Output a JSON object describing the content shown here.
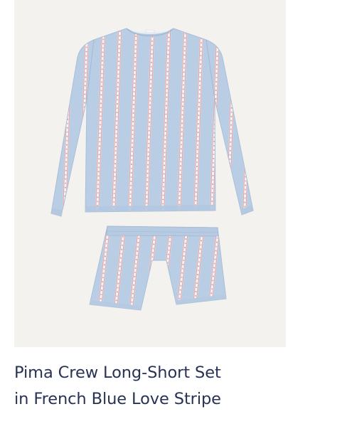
{
  "product": {
    "title_line1": "Pima Crew Long-Short Set",
    "title_line2": "in French Blue Love Stripe",
    "image_alt": "Pima Crew Long-Short Set in French Blue Love Stripe",
    "colors": {
      "image_background": "#f4f2ee",
      "fabric_blue": "#b9cee4",
      "stripe_white": "#f7f4f3",
      "stripe_pink": "#d8a7b0",
      "title_text": "#283354"
    }
  }
}
